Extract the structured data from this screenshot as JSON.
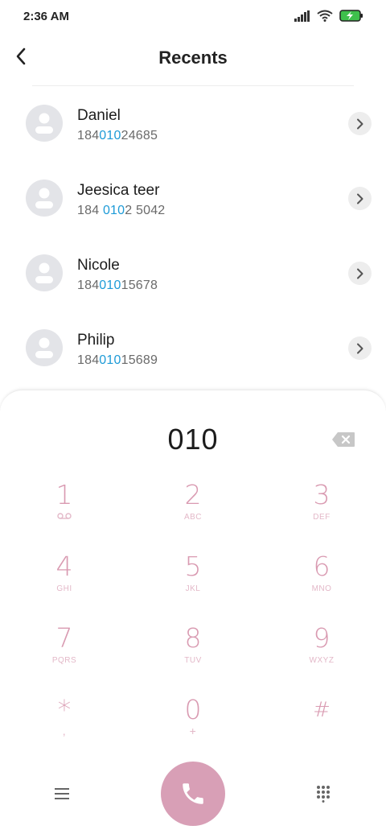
{
  "status_bar": {
    "time": "2:36 AM",
    "icons": [
      "signal-icon",
      "wifi-icon",
      "battery-charging-icon"
    ]
  },
  "header": {
    "title": "Recents",
    "back_icon": "chevron-left-icon"
  },
  "contacts": [
    {
      "name": "Daniel",
      "number_parts": [
        "184",
        "010",
        "24685"
      ]
    },
    {
      "name": "Jeesica teer",
      "number_parts": [
        "184 ",
        "010",
        "2 5042"
      ]
    },
    {
      "name": "Nicole",
      "number_parts": [
        "184",
        "010",
        "15678"
      ]
    },
    {
      "name": "Philip",
      "number_parts": [
        "184",
        "010",
        "15689"
      ]
    }
  ],
  "dialpad": {
    "entered": "010",
    "keys": [
      {
        "digit": "1",
        "sub": "voicemail-icon"
      },
      {
        "digit": "2",
        "sub": "ABC"
      },
      {
        "digit": "3",
        "sub": "DEF"
      },
      {
        "digit": "4",
        "sub": "GHI"
      },
      {
        "digit": "5",
        "sub": "JKL"
      },
      {
        "digit": "6",
        "sub": "MNO"
      },
      {
        "digit": "7",
        "sub": "PQRS"
      },
      {
        "digit": "8",
        "sub": "TUV"
      },
      {
        "digit": "9",
        "sub": "WXYZ"
      },
      {
        "digit": "*",
        "sub": ","
      },
      {
        "digit": "0",
        "sub": "+"
      },
      {
        "digit": "#",
        "sub": ""
      }
    ]
  },
  "colors": {
    "highlight": "#1e9bd7",
    "key_digit": "#d99ab1",
    "call_button": "#d89fb6"
  }
}
